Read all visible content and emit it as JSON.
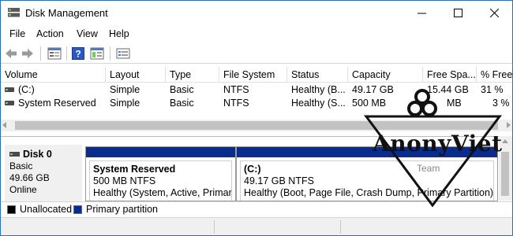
{
  "window": {
    "title": "Disk Management",
    "accent": "#1e6fd0"
  },
  "menu": {
    "file": "File",
    "action": "Action",
    "view": "View",
    "help": "Help"
  },
  "volume_table": {
    "headers": [
      "Volume",
      "Layout",
      "Type",
      "File System",
      "Status",
      "Capacity",
      "Free Spa...",
      "% Free"
    ],
    "rows": [
      {
        "volume": "(C:)",
        "layout": "Simple",
        "type": "Basic",
        "fs": "NTFS",
        "status": "Healthy (B...",
        "capacity": "49.17 GB",
        "free": "15.44 GB",
        "pct": "31 %"
      },
      {
        "volume": "System Reserved",
        "layout": "Simple",
        "type": "Basic",
        "fs": "NTFS",
        "status": "Healthy (S...",
        "capacity": "500 MB",
        "free": "MB",
        "pct": "3 %"
      }
    ]
  },
  "disk0": {
    "name": "Disk 0",
    "type": "Basic",
    "size": "49.66 GB",
    "state": "Online",
    "partitions": [
      {
        "name": "System Reserved",
        "size": "500 MB NTFS",
        "status": "Healthy (System, Active, Primary"
      },
      {
        "name": "(C:)",
        "size": "49.17 GB NTFS",
        "status": "Healthy (Boot, Page File, Crash Dump, Primary Partition)"
      }
    ]
  },
  "legend": {
    "unallocated": "Unallocated",
    "primary": "Primary partition",
    "unallocated_color": "#000000",
    "primary_color": "#0a2c8f"
  },
  "watermark": {
    "text": "AnonyViet",
    "sub": "Team"
  }
}
